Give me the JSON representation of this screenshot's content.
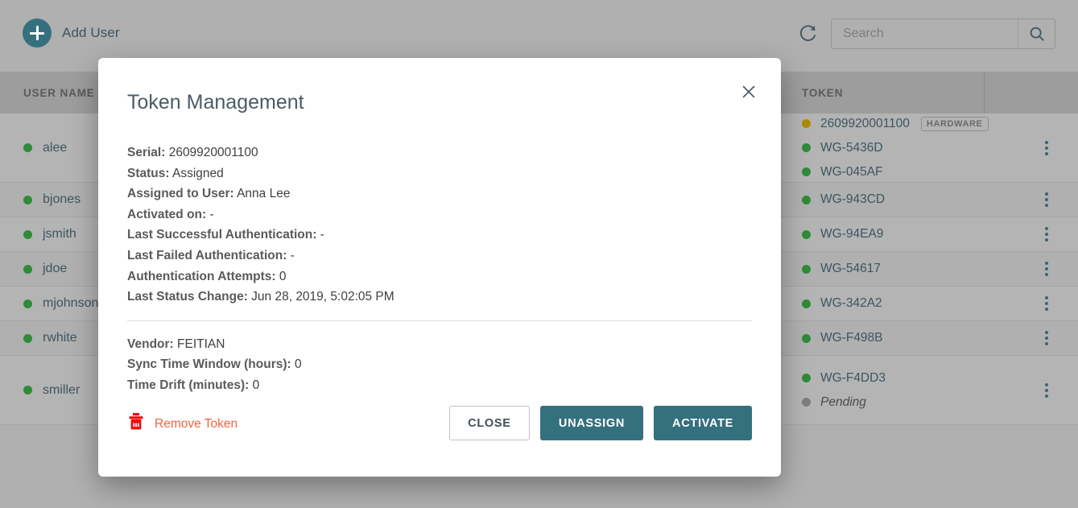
{
  "toolbar": {
    "add_user_label": "Add User",
    "add_user_icon": "plus-circle-icon",
    "refresh_icon": "refresh-icon",
    "search_icon": "search-icon",
    "search_value": "",
    "search_placeholder": "Search"
  },
  "table": {
    "columns": [
      "USER NAME",
      "TOKEN"
    ],
    "rows": [
      {
        "user": "alee",
        "user_status": "green",
        "tokens": [
          {
            "name": "2609920001100",
            "status": "amber",
            "badge": "HARDWARE"
          },
          {
            "name": "WG-5436D",
            "status": "green",
            "badge": ""
          },
          {
            "name": "WG-045AF",
            "status": "green",
            "badge": ""
          }
        ]
      },
      {
        "user": "bjones",
        "user_status": "green",
        "tokens": [
          {
            "name": "WG-943CD",
            "status": "green",
            "badge": ""
          }
        ]
      },
      {
        "user": "jsmith",
        "user_status": "green",
        "tokens": [
          {
            "name": "WG-94EA9",
            "status": "green",
            "badge": ""
          }
        ]
      },
      {
        "user": "jdoe",
        "user_status": "green",
        "tokens": [
          {
            "name": "WG-54617",
            "status": "green",
            "badge": ""
          }
        ]
      },
      {
        "user": "mjohnson",
        "user_status": "green",
        "tokens": [
          {
            "name": "WG-342A2",
            "status": "green",
            "badge": ""
          }
        ]
      },
      {
        "user": "rwhite",
        "user_status": "green",
        "tokens": [
          {
            "name": "WG-F498B",
            "status": "green",
            "badge": ""
          }
        ]
      },
      {
        "user": "smiller",
        "user_status": "green",
        "tokens": [
          {
            "name": "WG-F4DD3",
            "status": "green",
            "badge": ""
          },
          {
            "name": "Pending",
            "status": "grey",
            "badge": "",
            "italic": true
          }
        ]
      }
    ]
  },
  "modal": {
    "title": "Token Management",
    "close_icon": "close-icon",
    "details_primary": [
      {
        "key": "Serial",
        "value": "2609920001100"
      },
      {
        "key": "Status",
        "value": "Assigned"
      },
      {
        "key": "Assigned to User",
        "value": "Anna Lee"
      },
      {
        "key": "Activated on",
        "value": "-"
      },
      {
        "key": "Last Successful Authentication",
        "value": "-"
      },
      {
        "key": "Last Failed Authentication",
        "value": "-"
      },
      {
        "key": "Authentication Attempts",
        "value": "0"
      },
      {
        "key": "Last Status Change",
        "value": "Jun 28, 2019, 5:02:05 PM"
      }
    ],
    "details_secondary": [
      {
        "key": "Vendor",
        "value": "FEITIAN"
      },
      {
        "key": "Sync Time Window (hours)",
        "value": "0"
      },
      {
        "key": "Time Drift (minutes)",
        "value": "0"
      }
    ],
    "remove_token_label": "Remove Token",
    "remove_token_icon": "trash-icon",
    "buttons": [
      {
        "label": "CLOSE",
        "style": "ghost",
        "name": "close-button"
      },
      {
        "label": "UNASSIGN",
        "style": "primary",
        "name": "unassign-button"
      },
      {
        "label": "ACTIVATE",
        "style": "primary",
        "name": "activate-button"
      }
    ]
  },
  "colors": {
    "accent_teal": "#35707e",
    "page_bg": "#b0b0b0",
    "header_bg": "#9d9d9d",
    "row_bg": "#b4b4b4",
    "status_green": "#2f8b38",
    "status_amber": "#b08a06",
    "status_grey": "#7e7e7e",
    "danger_red": "#f4623a",
    "text_slate": "#3d5560"
  }
}
